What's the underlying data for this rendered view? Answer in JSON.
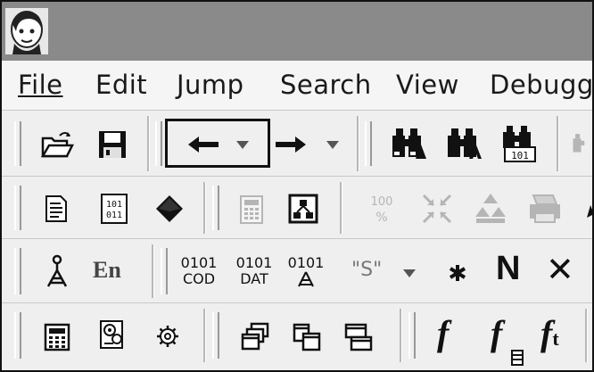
{
  "menu": {
    "items": [
      {
        "label": "File"
      },
      {
        "label": "Edit"
      },
      {
        "label": "Jump"
      },
      {
        "label": "Search"
      },
      {
        "label": "View"
      },
      {
        "label": "Debugger"
      }
    ]
  },
  "toolbar2": {
    "icons": [
      "open-folder-icon",
      "save-disk-icon",
      "back-arrow-icon",
      "back-dropdown-icon",
      "forward-arrow-icon",
      "forward-dropdown-icon",
      "binoculars-text-icon",
      "binoculars-code-icon",
      "binoculars-binary-icon"
    ]
  },
  "toolbar3": {
    "icons": [
      "text-view-icon",
      "hex-view-icon",
      "diamond-icon",
      "calculator-disabled-icon",
      "graph-icon"
    ],
    "hex_top": "101",
    "hex_bottom": "011",
    "percent_top": "100",
    "percent_bottom": "%"
  },
  "toolbar4": {
    "en_label": "En",
    "code_bits": "0101",
    "code_label": "COD",
    "data_bits": "0101",
    "data_label": "DAT",
    "struct_bits": "0101",
    "string_label": "\"S\"",
    "n_label": "N",
    "x_label": "✕"
  },
  "toolbar5": {
    "f_label": "f",
    "ft_sub": "t"
  },
  "colors": {
    "titlebar": "#8a8a8a",
    "toolbar_bg": "#efefef",
    "icon_dark": "#111111",
    "disabled": "#b5b5b5"
  }
}
